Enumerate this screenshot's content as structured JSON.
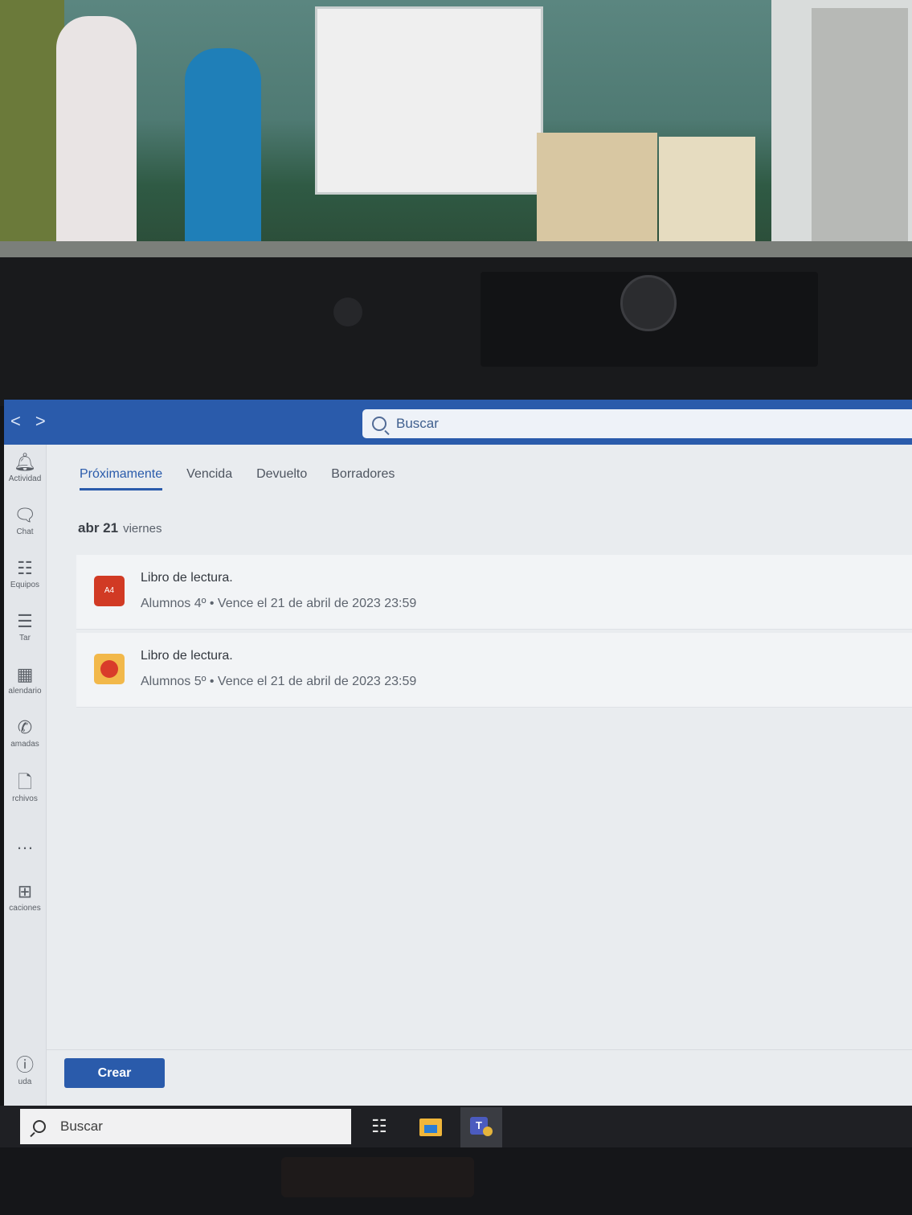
{
  "titlebar": {
    "nav_back": "<",
    "nav_forward": ">",
    "search_placeholder": "Buscar"
  },
  "rail": {
    "items": [
      {
        "label": "Actividad",
        "icon": "bell-icon"
      },
      {
        "label": "Chat",
        "icon": "chat-icon"
      },
      {
        "label": "Equipos",
        "icon": "teams-icon"
      },
      {
        "label": "Tar",
        "icon": "assignments-icon"
      },
      {
        "label": "alendario",
        "icon": "calendar-icon"
      },
      {
        "label": "amadas",
        "icon": "phone-icon"
      },
      {
        "label": "rchivos",
        "icon": "file-icon"
      },
      {
        "label": "",
        "icon": "more-icon"
      },
      {
        "label": "caciones",
        "icon": "apps-icon"
      },
      {
        "label": "uda",
        "icon": "help-icon"
      }
    ]
  },
  "tabs": [
    {
      "label": "Próximamente",
      "active": true
    },
    {
      "label": "Vencida",
      "active": false
    },
    {
      "label": "Devuelto",
      "active": false
    },
    {
      "label": "Borradores",
      "active": false
    }
  ],
  "date_group": {
    "date": "abr 21",
    "weekday": "viernes"
  },
  "assignments": [
    {
      "badge": "A4",
      "title": "Libro de lectura.",
      "meta": "Alumnos 4º • Vence el 21 de abril de 2023 23:59"
    },
    {
      "badge": "",
      "title": "Libro de lectura.",
      "meta": "Alumnos 5º • Vence el 21 de abril de 2023 23:59"
    }
  ],
  "create_button": "Crear",
  "taskbar": {
    "search_placeholder": "Buscar"
  },
  "colors": {
    "accent": "#2a5bab",
    "badge_red": "#d13a24",
    "badge_orange": "#f2b84a"
  }
}
